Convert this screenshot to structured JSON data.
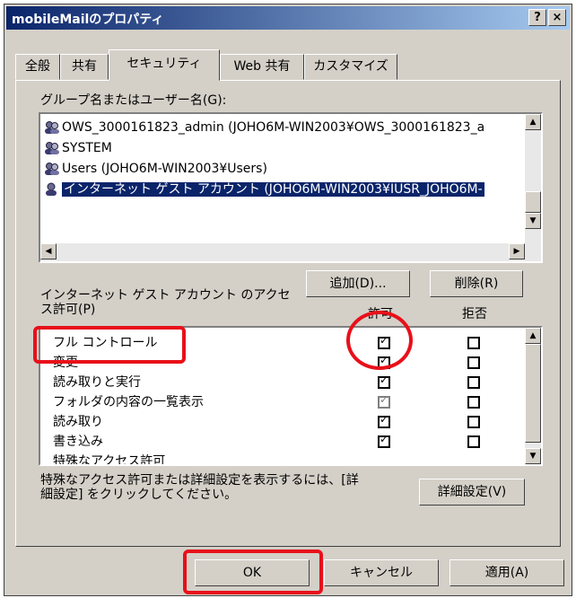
{
  "window": {
    "title": "mobileMailのプロパティ",
    "help_btn": "?",
    "close_btn": "×"
  },
  "tabs": [
    {
      "label": "全般"
    },
    {
      "label": "共有"
    },
    {
      "label": "セキュリティ"
    },
    {
      "label": "Web 共有"
    },
    {
      "label": "カスタマイズ"
    }
  ],
  "groups": {
    "label": "グループ名またはユーザー名(G):",
    "items": [
      {
        "name": "OWS_3000161823_admin (JOHO6M-WIN2003¥OWS_3000161823_a"
      },
      {
        "name": "SYSTEM"
      },
      {
        "name": "Users (JOHO6M-WIN2003¥Users)"
      },
      {
        "name": "インターネット ゲスト アカウント (JOHO6M-WIN2003¥IUSR_JOHO6M-"
      }
    ],
    "add_btn": "追加(D)...",
    "remove_btn": "削除(R)"
  },
  "permissions": {
    "label_line1": "インターネット ゲスト アカウント のアクセ",
    "label_line2": "ス許可(P)",
    "allow_header": "許可",
    "deny_header": "拒否",
    "rows": [
      {
        "name": "フル コントロール",
        "allow": true,
        "deny": false
      },
      {
        "name": "変更",
        "allow": true,
        "deny": false
      },
      {
        "name": "読み取りと実行",
        "allow": true,
        "deny": false
      },
      {
        "name": "フォルダの内容の一覧表示",
        "allow": true,
        "deny": false
      },
      {
        "name": "読み取り",
        "allow": true,
        "deny": false
      },
      {
        "name": "書き込み",
        "allow": true,
        "deny": false
      },
      {
        "name": "特殊なアクセス許可",
        "allow": false,
        "deny": false
      }
    ]
  },
  "advanced": {
    "note_line1": "特殊なアクセス許可または詳細設定を表示するには、[詳",
    "note_line2": "細設定] をクリックしてください。",
    "btn": "詳細設定(V)"
  },
  "footer": {
    "ok": "OK",
    "cancel": "キャンセル",
    "apply": "適用(A)"
  },
  "colors": {
    "highlight": "#e8101a",
    "selection": "#0a246a",
    "title_gradient_start": "#0a246a"
  }
}
